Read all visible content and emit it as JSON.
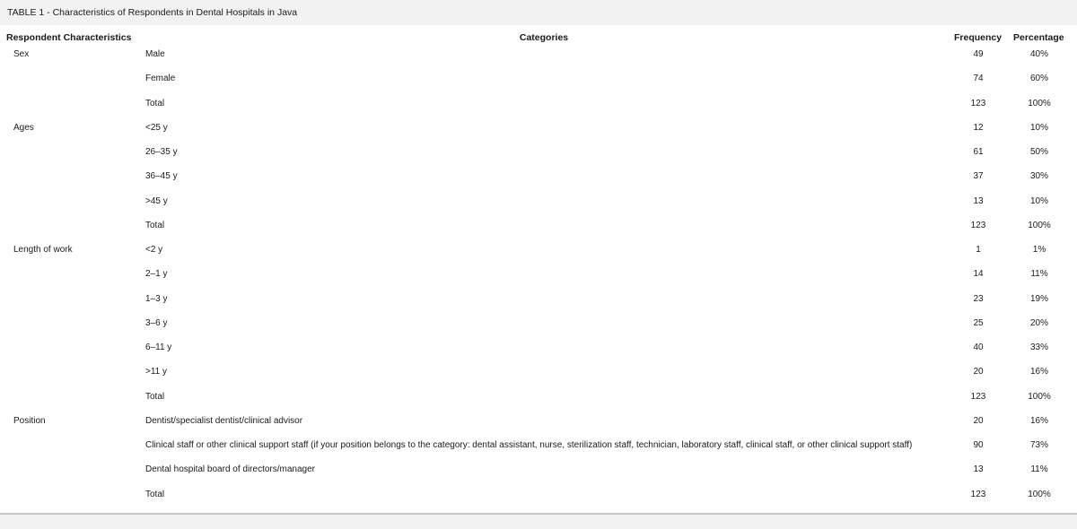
{
  "caption": "TABLE 1 - Characteristics of Respondents in Dental Hospitals in Java",
  "headers": {
    "characteristics": "Respondent Characteristics",
    "categories": "Categories",
    "frequency": "Frequency",
    "percentage": "Percentage"
  },
  "rows": [
    {
      "characteristic": "Sex",
      "category": "Male",
      "frequency": "49",
      "percentage": "40%"
    },
    {
      "characteristic": "",
      "category": "Female",
      "frequency": "74",
      "percentage": "60%"
    },
    {
      "characteristic": "",
      "category": "Total",
      "frequency": "123",
      "percentage": "100%"
    },
    {
      "characteristic": "Ages",
      "category": "<25 y",
      "frequency": "12",
      "percentage": "10%"
    },
    {
      "characteristic": "",
      "category": "26–35 y",
      "frequency": "61",
      "percentage": "50%"
    },
    {
      "characteristic": "",
      "category": "36–45 y",
      "frequency": "37",
      "percentage": "30%"
    },
    {
      "characteristic": "",
      "category": ">45 y",
      "frequency": "13",
      "percentage": "10%"
    },
    {
      "characteristic": "",
      "category": "Total",
      "frequency": "123",
      "percentage": "100%"
    },
    {
      "characteristic": "Length of work",
      "category": "<2 y",
      "frequency": "1",
      "percentage": "1%"
    },
    {
      "characteristic": "",
      "category": "2–1 y",
      "frequency": "14",
      "percentage": "11%"
    },
    {
      "characteristic": "",
      "category": "1–3 y",
      "frequency": "23",
      "percentage": "19%"
    },
    {
      "characteristic": "",
      "category": "3–6 y",
      "frequency": "25",
      "percentage": "20%"
    },
    {
      "characteristic": "",
      "category": "6–11 y",
      "frequency": "40",
      "percentage": "33%"
    },
    {
      "characteristic": "",
      "category": ">11 y",
      "frequency": "20",
      "percentage": "16%"
    },
    {
      "characteristic": "",
      "category": "Total",
      "frequency": "123",
      "percentage": "100%"
    },
    {
      "characteristic": "Position",
      "category": "Dentist/specialist dentist/clinical advisor",
      "frequency": "20",
      "percentage": "16%"
    },
    {
      "characteristic": "",
      "category": "Clinical staff or other clinical support staff (if your position belongs to the category: dental assistant, nurse, sterilization staff, technician, laboratory staff, clinical staff, or other clinical support staff)",
      "frequency": "90",
      "percentage": "73%"
    },
    {
      "characteristic": "",
      "category": "Dental hospital board of directors/manager",
      "frequency": "13",
      "percentage": "11%"
    },
    {
      "characteristic": "",
      "category": "Total",
      "frequency": "123",
      "percentage": "100%"
    }
  ]
}
